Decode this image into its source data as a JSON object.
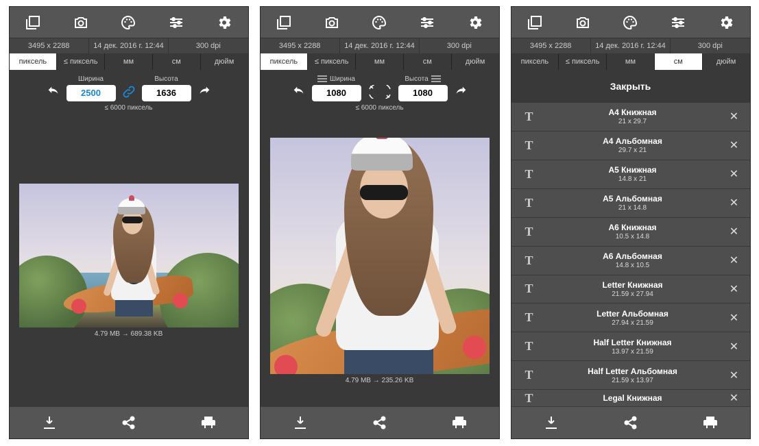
{
  "topbar_icons": [
    "gallery-icon",
    "camera-icon",
    "palette-icon",
    "sliders-icon",
    "gear-icon"
  ],
  "info": {
    "dimensions": "3495 x 2288",
    "date": "14 дек. 2016 г. 12:44",
    "dpi": "300 dpi"
  },
  "units": [
    "пиксель",
    "≤ пиксель",
    "мм",
    "см",
    "дюйм"
  ],
  "screen1": {
    "active_unit": 0,
    "width_label": "Ширина",
    "height_label": "Высота",
    "width_value": "2500",
    "height_value": "1636",
    "max_note": "≤ 6000 пиксель",
    "filesize": "4.79 MB → 689.38 KB"
  },
  "screen2": {
    "active_unit": 0,
    "width_label": "Ширина",
    "height_label": "Высота",
    "width_value": "1080",
    "height_value": "1080",
    "max_note": "≤ 6000 пиксель",
    "filesize": "4.79 MB → 235.26 KB"
  },
  "screen3": {
    "active_unit": 3,
    "close_label": "Закрыть",
    "presets": [
      {
        "name": "A4 Книжная",
        "dims": "21 x 29.7"
      },
      {
        "name": "A4 Альбомная",
        "dims": "29.7 x 21"
      },
      {
        "name": "A5 Книжная",
        "dims": "14.8 x 21"
      },
      {
        "name": "A5 Альбомная",
        "dims": "21 x 14.8"
      },
      {
        "name": "A6 Книжная",
        "dims": "10.5 x 14.8"
      },
      {
        "name": "A6 Альбомная",
        "dims": "14.8 x 10.5"
      },
      {
        "name": "Letter Книжная",
        "dims": "21.59 x 27.94"
      },
      {
        "name": "Letter Альбомная",
        "dims": "27.94 x 21.59"
      },
      {
        "name": "Half Letter Книжная",
        "dims": "13.97 x 21.59"
      },
      {
        "name": "Half Letter Альбомная",
        "dims": "21.59 x 13.97"
      }
    ],
    "last_partial": "Legal Книжная"
  },
  "bottom_icons": [
    "download-icon",
    "share-icon",
    "print-icon"
  ],
  "preset_t_glyph": "T"
}
